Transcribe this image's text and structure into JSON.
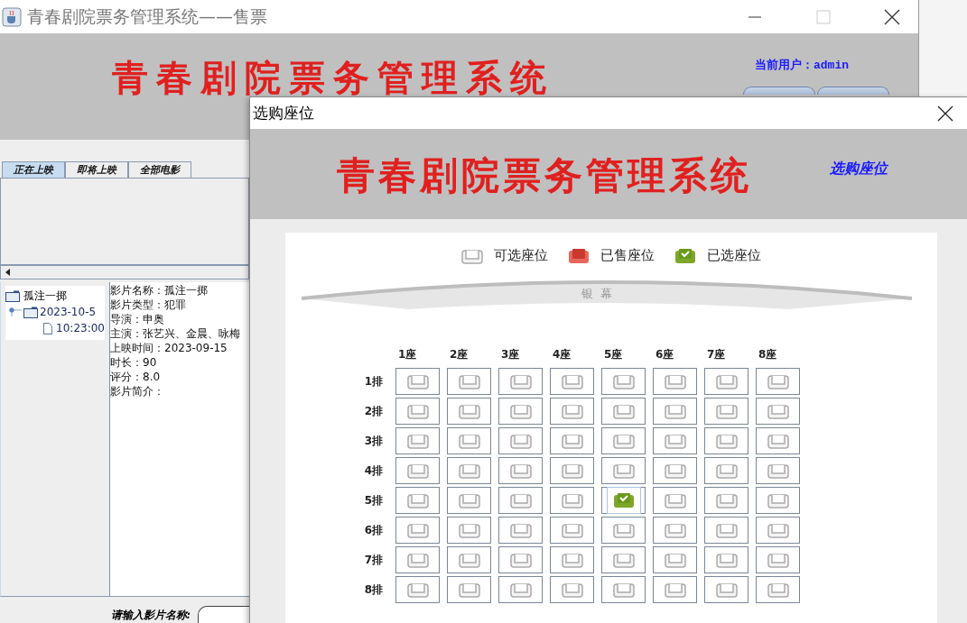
{
  "main_window": {
    "title": "青春剧院票务管理系统——售票",
    "banner_title": "青春剧院票务管理系统",
    "user_label": "当前用户：admin",
    "tabs": [
      {
        "label": "正在上映",
        "selected": true
      },
      {
        "label": "即将上映",
        "selected": false
      },
      {
        "label": "全部电影",
        "selected": false
      }
    ],
    "tree": [
      {
        "label": "孤注一掷",
        "children": [
          {
            "label": "2023-10-5",
            "expanded": true,
            "children": [
              {
                "label": "10:23:00"
              }
            ]
          }
        ]
      }
    ],
    "movie_info": [
      "影片名称：孤注一掷",
      "影片类型：犯罪",
      "导演：申奥",
      "主演：张艺兴、金晨、咏梅",
      "上映时间：2023-09-15",
      "时长：90",
      "评分：8.0",
      "影片简介："
    ],
    "search": {
      "label": "请输入影片名称:"
    }
  },
  "dialog": {
    "title": "选购座位",
    "banner_title": "青春剧院票务管理系统",
    "banner_subtitle": "选购座位",
    "legend": [
      {
        "kind": "available",
        "label": "可选座位"
      },
      {
        "kind": "sold",
        "label": "已售座位"
      },
      {
        "kind": "selected",
        "label": "已选座位"
      }
    ],
    "screen_label": "银  幕",
    "columns": [
      "1座",
      "2座",
      "3座",
      "4座",
      "5座",
      "6座",
      "7座",
      "8座"
    ],
    "rows": [
      {
        "label": "1排",
        "seats": [
          {
            "selected": false
          },
          {
            "selected": false
          },
          {
            "selected": false
          },
          {
            "selected": false
          },
          {
            "selected": false
          },
          {
            "selected": false
          },
          {
            "selected": false
          },
          {
            "selected": false
          }
        ]
      },
      {
        "label": "2排",
        "seats": [
          {
            "selected": false
          },
          {
            "selected": false
          },
          {
            "selected": false
          },
          {
            "selected": false
          },
          {
            "selected": false
          },
          {
            "selected": false
          },
          {
            "selected": false
          },
          {
            "selected": false
          }
        ]
      },
      {
        "label": "3排",
        "seats": [
          {
            "selected": false
          },
          {
            "selected": false
          },
          {
            "selected": false
          },
          {
            "selected": false
          },
          {
            "selected": false
          },
          {
            "selected": false
          },
          {
            "selected": false
          },
          {
            "selected": false
          }
        ]
      },
      {
        "label": "4排",
        "seats": [
          {
            "selected": false
          },
          {
            "selected": false
          },
          {
            "selected": false
          },
          {
            "selected": false
          },
          {
            "selected": false
          },
          {
            "selected": false
          },
          {
            "selected": false
          },
          {
            "selected": false
          }
        ]
      },
      {
        "label": "5排",
        "seats": [
          {
            "selected": false
          },
          {
            "selected": false
          },
          {
            "selected": false
          },
          {
            "selected": false
          },
          {
            "selected": true
          },
          {
            "selected": false
          },
          {
            "selected": false
          },
          {
            "selected": false
          }
        ]
      },
      {
        "label": "6排",
        "seats": [
          {
            "selected": false
          },
          {
            "selected": false
          },
          {
            "selected": false
          },
          {
            "selected": false
          },
          {
            "selected": false
          },
          {
            "selected": false
          },
          {
            "selected": false
          },
          {
            "selected": false
          }
        ]
      },
      {
        "label": "7排",
        "seats": [
          {
            "selected": false
          },
          {
            "selected": false
          },
          {
            "selected": false
          },
          {
            "selected": false
          },
          {
            "selected": false
          },
          {
            "selected": false
          },
          {
            "selected": false
          },
          {
            "selected": false
          }
        ]
      },
      {
        "label": "8排",
        "seats": [
          {
            "selected": false
          },
          {
            "selected": false
          },
          {
            "selected": false
          },
          {
            "selected": false
          },
          {
            "selected": false
          },
          {
            "selected": false
          },
          {
            "selected": false
          },
          {
            "selected": false
          }
        ]
      }
    ]
  }
}
